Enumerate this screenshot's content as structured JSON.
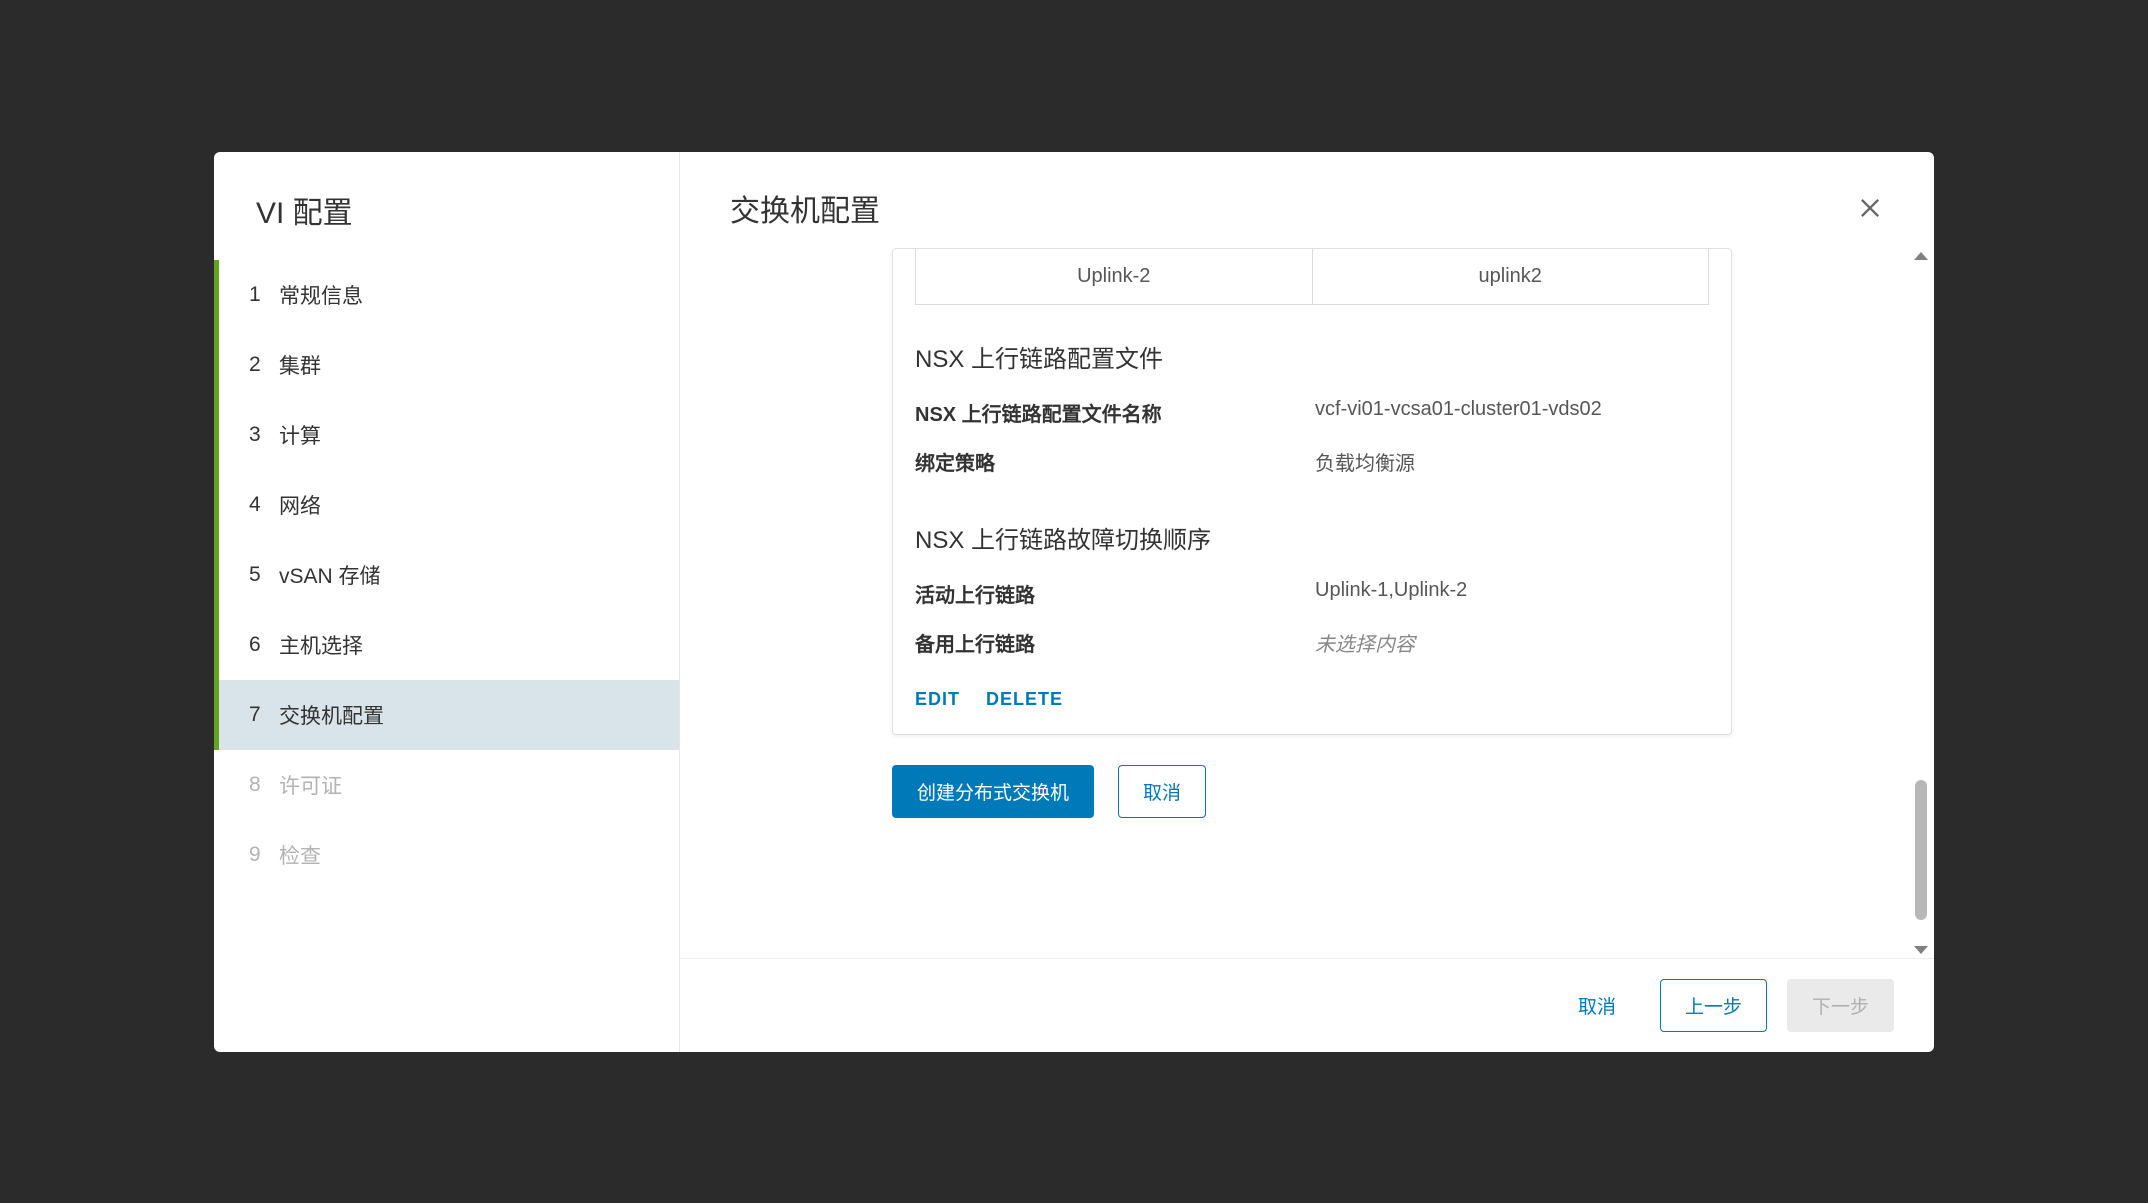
{
  "sidebar": {
    "title": "VI 配置",
    "steps": [
      {
        "num": "1",
        "label": "常规信息",
        "state": "completed"
      },
      {
        "num": "2",
        "label": "集群",
        "state": "completed"
      },
      {
        "num": "3",
        "label": "计算",
        "state": "completed"
      },
      {
        "num": "4",
        "label": "网络",
        "state": "completed"
      },
      {
        "num": "5",
        "label": "vSAN 存储",
        "state": "completed"
      },
      {
        "num": "6",
        "label": "主机选择",
        "state": "completed"
      },
      {
        "num": "7",
        "label": "交换机配置",
        "state": "active"
      },
      {
        "num": "8",
        "label": "许可证",
        "state": "disabled"
      },
      {
        "num": "9",
        "label": "检查",
        "state": "disabled"
      }
    ]
  },
  "main": {
    "title": "交换机配置",
    "uplink_row": {
      "col1": "Uplink-2",
      "col2": "uplink2"
    },
    "section_profile": {
      "title": "NSX 上行链路配置文件",
      "name_label": "NSX 上行链路配置文件名称",
      "name_value": "vcf-vi01-vcsa01-cluster01-vds02",
      "policy_label": "绑定策略",
      "policy_value": "负载均衡源"
    },
    "section_failover": {
      "title": "NSX 上行链路故障切换顺序",
      "active_label": "活动上行链路",
      "active_value": "Uplink-1,Uplink-2",
      "standby_label": "备用上行链路",
      "standby_value": "未选择内容"
    },
    "card_actions": {
      "edit": "EDIT",
      "delete": "DELETE"
    },
    "below": {
      "create": "创建分布式交换机",
      "cancel": "取消"
    },
    "footer": {
      "cancel": "取消",
      "prev": "上一步",
      "next": "下一步"
    }
  }
}
